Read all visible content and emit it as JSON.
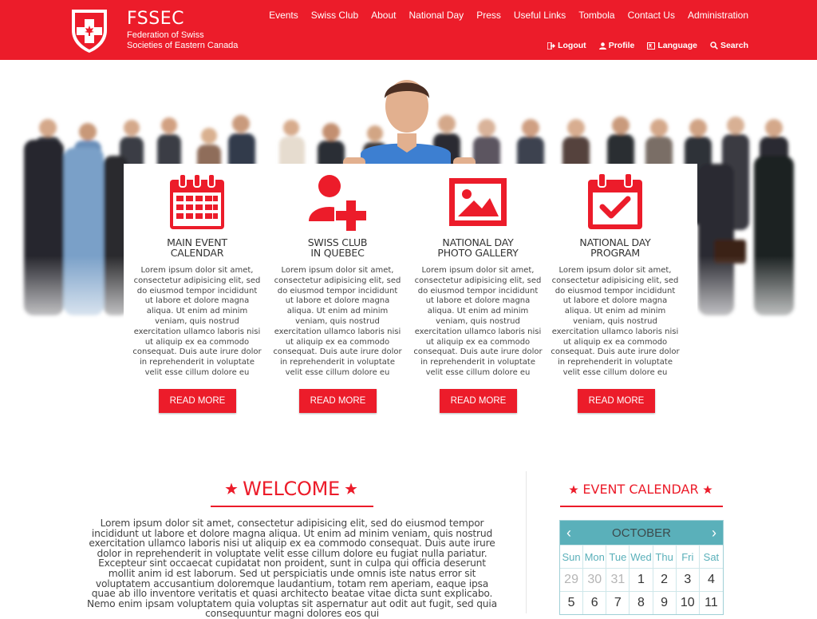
{
  "brand": {
    "title": "FSSEC",
    "subtitle_line1": "Federation of Swiss",
    "subtitle_line2": "Societies of Eastern Canada"
  },
  "main_nav": [
    "Events",
    "Swiss Club",
    "About",
    "National Day",
    "Press",
    "Useful Links",
    "Tombola",
    "Contact Us",
    "Administration"
  ],
  "sub_nav": [
    {
      "label": "Logout",
      "icon": "logout-icon"
    },
    {
      "label": "Profile",
      "icon": "user-icon"
    },
    {
      "label": "Language",
      "icon": "language-icon"
    },
    {
      "label": "Search",
      "icon": "search-icon"
    }
  ],
  "features": [
    {
      "icon": "calendar-icon",
      "title_line1": "MAIN EVENT",
      "title_line2": "CALENDAR",
      "text": "Lorem ipsum dolor sit amet, consectetur adipisicing elit, sed do eiusmod tempor incididunt ut labore et dolore magna aliqua. Ut enim ad minim veniam, quis nostrud exercitation ullamco laboris nisi ut aliquip ex ea commodo consequat. Duis aute irure dolor in reprehenderit in voluptate velit esse cillum dolore eu fugiat nulla pariatur. Excepteur",
      "button": "READ MORE"
    },
    {
      "icon": "add-user-icon",
      "title_line1": "SWISS CLUB",
      "title_line2": "IN QUEBEC",
      "text": "Lorem ipsum dolor sit amet, consectetur adipisicing elit, sed do eiusmod tempor incididunt ut labore et dolore magna aliqua. Ut enim ad minim veniam, quis nostrud exercitation ullamco laboris nisi ut aliquip ex ea commodo consequat. Duis aute irure dolor in reprehenderit in voluptate velit esse cillum dolore eu fugiat nulla pariatur. Excepteur",
      "button": "READ MORE"
    },
    {
      "icon": "image-icon",
      "title_line1": "NATIONAL DAY",
      "title_line2": "PHOTO GALLERY",
      "text": "Lorem ipsum dolor sit amet, consectetur adipisicing elit, sed do eiusmod tempor incididunt ut labore et dolore magna aliqua. Ut enim ad minim veniam, quis nostrud exercitation ullamco laboris nisi ut aliquip ex ea commodo consequat. Duis aute irure dolor in reprehenderit in voluptate velit esse cillum dolore eu fugiat nulla pariatur. Excepteur",
      "button": "READ MORE"
    },
    {
      "icon": "calendar-check-icon",
      "title_line1": "NATIONAL DAY",
      "title_line2": "PROGRAM",
      "text": "Lorem ipsum dolor sit amet, consectetur adipisicing elit, sed do eiusmod tempor incididunt ut labore et dolore magna aliqua. Ut enim ad minim veniam, quis nostrud exercitation ullamco laboris nisi ut aliquip ex ea commodo consequat. Duis aute irure dolor in reprehenderit in voluptate velit esse cillum dolore eu fugiat nulla pariatur. Excepteur",
      "button": "READ MORE"
    }
  ],
  "welcome": {
    "title": "WELCOME",
    "text": "Lorem ipsum dolor sit amet, consectetur adipisicing elit, sed do eiusmod tempor incididunt ut labore et dolore magna aliqua. Ut enim ad minim veniam, quis nostrud exercitation ullamco laboris nisi ut aliquip ex ea commodo consequat. Duis aute irure dolor in reprehenderit in voluptate velit esse cillum dolore eu fugiat nulla pariatur. Excepteur sint occaecat cupidatat non proident, sunt in culpa qui officia deserunt mollit anim id est laborum. Sed ut perspiciatis unde omnis iste natus error sit voluptatem accusantium doloremque laudantium, totam rem aperiam, eaque ipsa quae ab illo inventore veritatis et quasi architecto beatae vitae dicta sunt explicabo. Nemo enim ipsam voluptatem quia voluptas sit aspernatur aut odit aut fugit, sed quia consequuntur magni dolores eos qui"
  },
  "event_calendar": {
    "title": "EVENT CALENDAR",
    "month": "OCTOBER",
    "weekdays": [
      "Sun",
      "Mon",
      "Tue",
      "Wed",
      "Thu",
      "Fri",
      "Sat"
    ],
    "weeks": [
      [
        {
          "d": "29",
          "muted": true
        },
        {
          "d": "30",
          "muted": true
        },
        {
          "d": "31",
          "muted": true
        },
        {
          "d": "1"
        },
        {
          "d": "2"
        },
        {
          "d": "3"
        },
        {
          "d": "4"
        }
      ],
      [
        {
          "d": "5"
        },
        {
          "d": "6"
        },
        {
          "d": "7"
        },
        {
          "d": "8"
        },
        {
          "d": "9"
        },
        {
          "d": "10"
        },
        {
          "d": "11"
        }
      ]
    ]
  },
  "colors": {
    "accent": "#ec1c2a",
    "calendar_teal": "#5ab0ba"
  }
}
